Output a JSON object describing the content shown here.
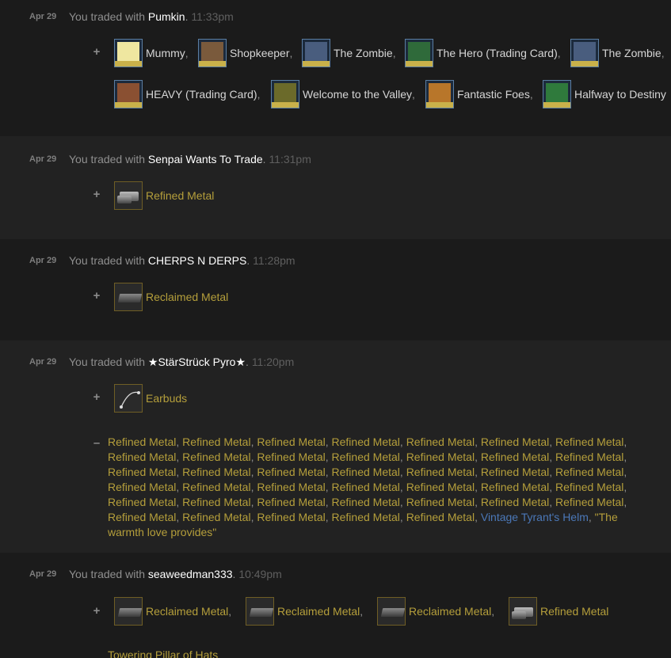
{
  "colors": {
    "background": "#1b1b1b",
    "background_alt": "#222222",
    "item_name": "#b59f3b",
    "partner": "#ffffff",
    "vintage": "#4b78b8",
    "item_border": "#6f5e25"
  },
  "trades": [
    {
      "date": "Apr 29",
      "prefix": "You traded with ",
      "partner": "Pumkin",
      "time": "11:33pm",
      "received_sign": "+",
      "received": [
        {
          "name": "Mummy",
          "sep": ",",
          "icon": "mummy-card-icon"
        },
        {
          "name": "Shopkeeper",
          "sep": ",",
          "icon": "shopkeeper-card-icon"
        },
        {
          "name": "The Zombie",
          "sep": ",",
          "icon": "zombie-card-icon"
        },
        {
          "name": "The Hero (Trading Card)",
          "sep": ",",
          "icon": "hero-card-icon"
        },
        {
          "name": "The Zombie",
          "sep": ",",
          "icon": "zombie-card-icon"
        },
        {
          "name": "HEAVY (Trading Card)",
          "sep": ",",
          "icon": "heavy-card-icon"
        },
        {
          "name": "Welcome to the Valley",
          "sep": ",",
          "icon": "valley-card-icon"
        },
        {
          "name": "Fantastic Foes",
          "sep": ",",
          "icon": "foes-card-icon"
        },
        {
          "name": "Halfway to Destiny",
          "sep": "",
          "icon": "destiny-card-icon"
        }
      ]
    },
    {
      "date": "Apr 29",
      "prefix": "You traded with ",
      "partner": "Senpai Wants To Trade",
      "time": "11:31pm",
      "received_sign": "+",
      "received": [
        {
          "name": "Refined Metal",
          "sep": "",
          "icon": "refined-metal-icon"
        }
      ]
    },
    {
      "date": "Apr 29",
      "prefix": "You traded with ",
      "partner": "CHERPS N DERPS",
      "time": "11:28pm",
      "received_sign": "+",
      "received": [
        {
          "name": "Reclaimed Metal",
          "sep": "",
          "icon": "reclaimed-metal-icon"
        }
      ]
    },
    {
      "date": "Apr 29",
      "prefix": "You traded with ",
      "partner": "★StärStrück Pyro★",
      "time": "11:20pm",
      "received_sign": "+",
      "received": [
        {
          "name": "Earbuds",
          "sep": "",
          "icon": "earbuds-icon"
        }
      ],
      "given_sign": "–",
      "given_refined": "Refined Metal",
      "given_refined_count": 40,
      "given_extra": [
        {
          "name": "Vintage Tyrant's Helm",
          "sep": ","
        },
        {
          "name": "\"The warmth love provides\"",
          "sep": ""
        }
      ]
    },
    {
      "date": "Apr 29",
      "prefix": "You traded with ",
      "partner": "seaweedman333",
      "time": "10:49pm",
      "received_sign": "+",
      "received": [
        {
          "name": "Reclaimed Metal",
          "sep": ",",
          "icon": "reclaimed-metal-icon"
        },
        {
          "name": "Reclaimed Metal",
          "sep": ",",
          "icon": "reclaimed-metal-icon"
        },
        {
          "name": "Reclaimed Metal",
          "sep": ",",
          "icon": "reclaimed-metal-icon"
        },
        {
          "name": "Refined Metal",
          "sep": "",
          "icon": "refined-metal-icon"
        }
      ],
      "partial_next": "Towering Pillar of Hats"
    }
  ]
}
